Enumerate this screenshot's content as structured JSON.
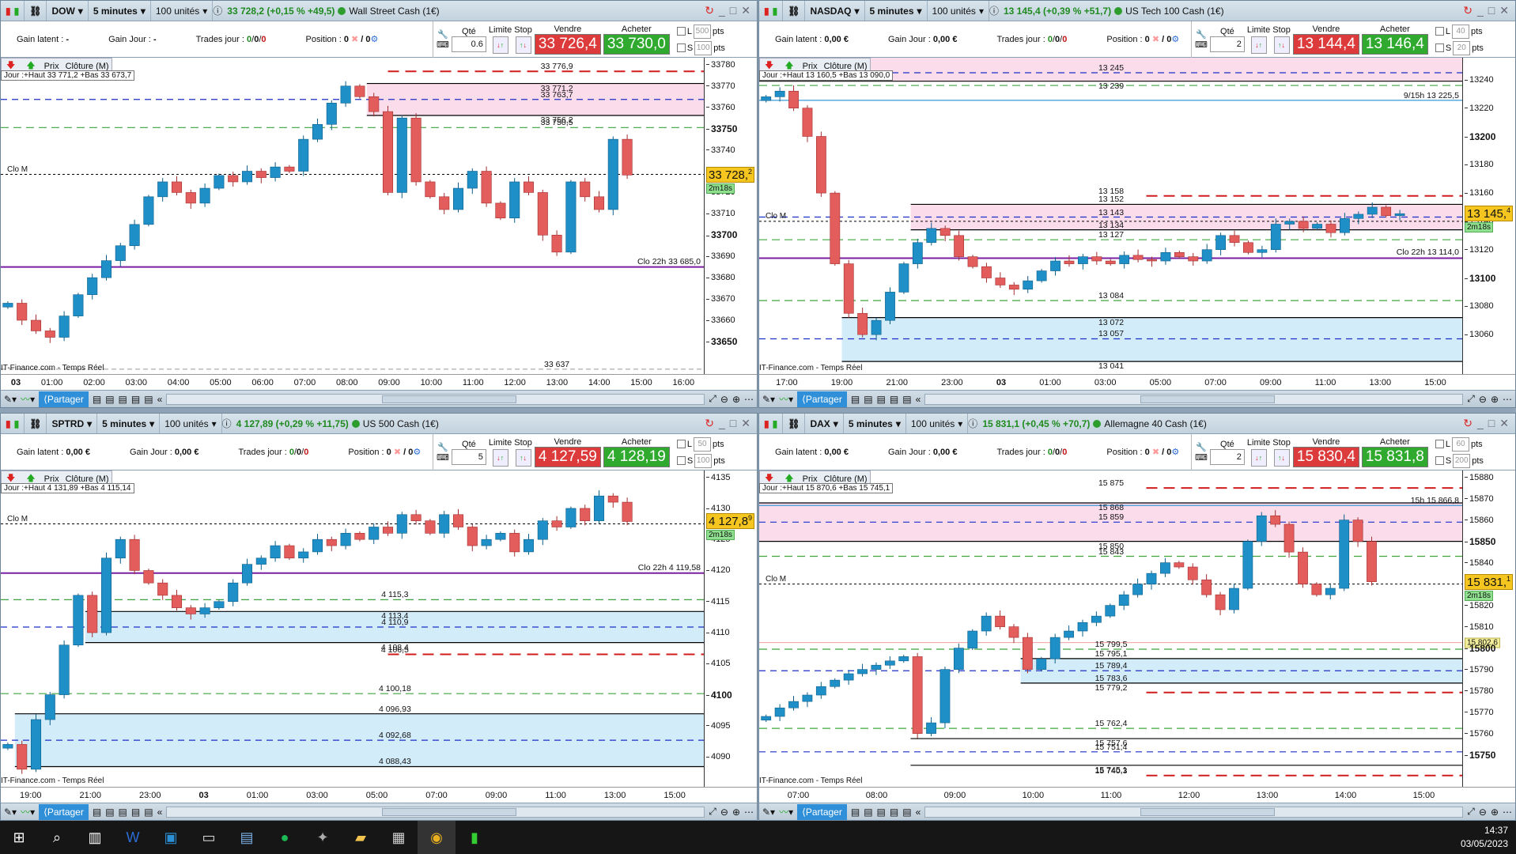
{
  "common": {
    "gain_latent_label": "Gain latent :",
    "gain_jour_label": "Gain Jour :",
    "trades_label": "Trades jour :",
    "position_label": "Position :",
    "qty_label": "Qté",
    "limit_label": "Limite",
    "stop_label": "Stop",
    "sell_label": "Vendre",
    "buy_label": "Acheter",
    "share_label": "Partager",
    "prix_label": "Prix",
    "cloture_label": "Clôture (M)",
    "source": "IT-Finance.com - Temps Réel",
    "clo_m": "Clo M",
    "timer": "2m18s",
    "L": "L",
    "S": "S",
    "pts": "pts",
    "trades": [
      "0",
      "0",
      "0"
    ],
    "position": "0",
    "position2": "/ 0"
  },
  "panels": [
    {
      "symbol": "DOW",
      "interval": "5 minutes",
      "units": "100 unités",
      "quote": "33 728,2 (+0,15 % +49,5)",
      "name": "Wall Street Cash (1€)",
      "gain_latent": "-",
      "gain_jour": "-",
      "qty": "0.6",
      "sell": "33 726,4",
      "buy": "33 730,0",
      "L_pts": "500",
      "S_pts": "100",
      "jour": "Jour :+Haut 33 771,2 +Bas 33 673,7",
      "last": "33 728,2",
      "last_value": 33728.2,
      "clo_m": 33728.5,
      "yrange": [
        33634,
        33783.3
      ],
      "ticks": [
        33650,
        33660,
        33670,
        33680,
        33690,
        33700,
        33710,
        33720,
        33730,
        33740,
        33750,
        33760,
        33770,
        33780
      ],
      "bold_ticks": [
        33650,
        33700,
        33750
      ],
      "times": [
        "03",
        "01:00",
        "02:00",
        "03:00",
        "04:00",
        "05:00",
        "06:00",
        "07:00",
        "08:00",
        "09:00",
        "10:00",
        "11:00",
        "12:00",
        "13:00",
        "14:00",
        "15:00",
        "16:00"
      ],
      "zones": [
        {
          "from": 33756.2,
          "to": 33771.2,
          "color": "#fbdcea",
          "from_index": 26
        }
      ],
      "levels": [
        {
          "price": 33776.9,
          "style": "red",
          "label": "33 776,9"
        },
        {
          "price": 33771.2,
          "style": "black",
          "label": "33 771,2"
        },
        {
          "price": 33763.7,
          "style": "blue",
          "label": "33 763,7"
        },
        {
          "price": 33756.2,
          "style": "black",
          "label": "33 756,2"
        },
        {
          "price": 33750.5,
          "style": "green",
          "label": "33 750,5"
        },
        {
          "price": 33637,
          "style": "grey",
          "label": "33 637"
        }
      ],
      "close_line": {
        "price": 33685.0,
        "label": "Clo 22h 33 685,0"
      },
      "closes": [
        33668,
        33660,
        33655,
        33652,
        33662,
        33672,
        33680,
        33688,
        33695,
        33705,
        33718,
        33725,
        33720,
        33715,
        33722,
        33728,
        33725,
        33730,
        33727,
        33732,
        33730,
        33745,
        33752,
        33762,
        33770,
        33765,
        33758,
        33720,
        33755,
        33725,
        33718,
        33712,
        33722,
        33730,
        33715,
        33708,
        33725,
        33720,
        33700,
        33692,
        33725,
        33718,
        33712,
        33745,
        33728.2
      ]
    },
    {
      "symbol": "NASDAQ",
      "interval": "5 minutes",
      "units": "100 unités",
      "quote": "13 145,4 (+0,39 % +51,7)",
      "name": "US Tech 100 Cash (1€)",
      "gain_latent": "0,00 €",
      "gain_jour": "0,00 €",
      "qty": "2",
      "sell": "13 144,4",
      "buy": "13 146,4",
      "L_pts": "40",
      "S_pts": "20",
      "jour": "Jour :+Haut 13 160,5 +Bas 13 090,0",
      "last": "13 145,4",
      "last_value": 13145.4,
      "clo_m": 13140,
      "yrange": [
        13031,
        13255.6
      ],
      "ticks": [
        13060,
        13080,
        13100,
        13120,
        13140,
        13160,
        13180,
        13200,
        13220,
        13240
      ],
      "bold_ticks": [
        13100,
        13200
      ],
      "times": [
        "17:00",
        "19:00",
        "21:00",
        "23:00",
        "03",
        "01:00",
        "03:00",
        "05:00",
        "07:00",
        "09:00",
        "11:00",
        "13:00",
        "15:00"
      ],
      "zones": [
        {
          "from": 13239,
          "to": 13260,
          "color": "#fbdcea",
          "from_index": 0
        },
        {
          "from": 13134,
          "to": 13152,
          "color": "#fbdcea",
          "from_index": 11
        },
        {
          "from": 13041,
          "to": 13072,
          "color": "#d3ecfa",
          "from_index": 6
        }
      ],
      "levels": [
        {
          "price": 13245,
          "style": "blue",
          "label": "13 245"
        },
        {
          "price": 13239,
          "style": "black",
          "label": "13 239"
        },
        {
          "price": 13236,
          "style": "green",
          "label": ""
        },
        {
          "price": 13158,
          "style": "red",
          "label": "13 158"
        },
        {
          "price": 13152,
          "style": "black",
          "label": "13 152"
        },
        {
          "price": 13143,
          "style": "blue",
          "label": "13 143"
        },
        {
          "price": 13134,
          "style": "black",
          "label": "13 134"
        },
        {
          "price": 13127,
          "style": "green",
          "label": "13 127"
        },
        {
          "price": 13084,
          "style": "green",
          "label": "13 084"
        },
        {
          "price": 13072,
          "style": "black",
          "label": "13 072"
        },
        {
          "price": 13057,
          "style": "blue",
          "label": "13 057"
        },
        {
          "price": 13041,
          "style": "black",
          "label": "13 041"
        }
      ],
      "info_line": {
        "price": 13225.5,
        "label": "9/15h 13 225,5"
      },
      "close_line": {
        "price": 13114.0,
        "label": "Clo 22h 13 114,0"
      },
      "closes": [
        13228,
        13232,
        13220,
        13200,
        13160,
        13110,
        13075,
        13060,
        13070,
        13090,
        13110,
        13125,
        13135,
        13130,
        13115,
        13108,
        13100,
        13095,
        13092,
        13098,
        13105,
        13112,
        13110,
        13115,
        13112,
        13110,
        13116,
        13113,
        13112,
        13118,
        13115,
        13112,
        13120,
        13130,
        13125,
        13118,
        13120,
        13138,
        13140,
        13135,
        13138,
        13132,
        13142,
        13145,
        13150,
        13144,
        13145.4
      ]
    },
    {
      "symbol": "SPTRD",
      "interval": "5 minutes",
      "units": "100 unités",
      "quote": "4 127,89 (+0,29 % +11,75)",
      "name": "US 500 Cash (1€)",
      "gain_latent": "0,00 €",
      "gain_jour": "0,00 €",
      "qty": "5",
      "sell": "4 127,59",
      "buy": "4 128,19",
      "L_pts": "50",
      "S_pts": "100",
      "jour": "Jour :+Haut 4 131,89 +Bas 4 115,14",
      "last": "4 127,89",
      "last_value": 4127.89,
      "clo_m": 4127.5,
      "yrange": [
        4086.2,
        4136.1
      ],
      "ticks": [
        4090,
        4095,
        4100,
        4105,
        4110,
        4115,
        4120,
        4125,
        4130,
        4135
      ],
      "bold_ticks": [
        4100
      ],
      "times": [
        "19:00",
        "21:00",
        "23:00",
        "03",
        "01:00",
        "03:00",
        "05:00",
        "07:00",
        "09:00",
        "11:00",
        "13:00",
        "15:00"
      ],
      "zones": [
        {
          "from": 4108.4,
          "to": 4113.4,
          "color": "#d3ecfa",
          "from_index": 6
        },
        {
          "from": 4088.43,
          "to": 4096.93,
          "color": "#d3ecfa",
          "from_index": 1
        }
      ],
      "levels": [
        {
          "price": 4115.3,
          "style": "green",
          "label": "4 115,3"
        },
        {
          "price": 4113.4,
          "style": "black",
          "label": "4 113,4"
        },
        {
          "price": 4110.9,
          "style": "blue",
          "label": "4 110,9"
        },
        {
          "price": 4108.4,
          "style": "black",
          "label": "4 108,4"
        },
        {
          "price": 4106.5,
          "style": "red",
          "label": "4 106,5"
        },
        {
          "price": 4100.18,
          "style": "green",
          "label": "4 100,18"
        },
        {
          "price": 4096.93,
          "style": "black",
          "label": "4 096,93"
        },
        {
          "price": 4092.68,
          "style": "blue",
          "label": "4 092,68"
        },
        {
          "price": 4088.43,
          "style": "black",
          "label": "4 088,43"
        }
      ],
      "close_line": {
        "price": 4119.58,
        "label": "Clo 22h 4 119,58"
      },
      "closes": [
        4092,
        4088,
        4096,
        4100,
        4108,
        4116,
        4110,
        4122,
        4125,
        4120,
        4118,
        4116,
        4114,
        4113,
        4114,
        4115,
        4118,
        4121,
        4122,
        4124,
        4122,
        4123,
        4125,
        4124,
        4126,
        4125,
        4127,
        4126,
        4129,
        4128,
        4126,
        4129,
        4127,
        4124,
        4125,
        4126,
        4123,
        4125,
        4128,
        4127,
        4130,
        4128,
        4132,
        4131,
        4127.89
      ]
    },
    {
      "symbol": "DAX",
      "interval": "5 minutes",
      "units": "100 unités",
      "quote": "15 831,1 (+0,45 % +70,7)",
      "name": "Allemagne 40 Cash (1€)",
      "gain_latent": "0,00 €",
      "gain_jour": "0,00 €",
      "qty": "2",
      "sell": "15 830,4",
      "buy": "15 831,8",
      "L_pts": "60",
      "S_pts": "200",
      "jour": "Jour :+Haut 15 870,6 +Bas 15 745,1",
      "last": "15 831,1",
      "last_value": 15831.1,
      "clo_m": 15830,
      "yrange": [
        15738,
        15883.2
      ],
      "ticks": [
        15750,
        15760,
        15770,
        15780,
        15790,
        15800,
        15810,
        15820,
        15830,
        15840,
        15850,
        15860,
        15870,
        15880
      ],
      "bold_ticks": [
        15750,
        15800,
        15850
      ],
      "times": [
        "07:00",
        "08:00",
        "09:00",
        "10:00",
        "11:00",
        "12:00",
        "13:00",
        "14:00",
        "15:00"
      ],
      "zones": [
        {
          "from": 15850,
          "to": 15868,
          "color": "#fbdcea",
          "from_index": 0
        },
        {
          "from": 15783.6,
          "to": 15795.1,
          "color": "#d3ecfa",
          "from_index": 19
        },
        {
          "from": 15745.1,
          "to": 15757.6,
          "color": "#fff",
          "from_index": 11
        }
      ],
      "levels": [
        {
          "price": 15875,
          "style": "red",
          "label": "15 875"
        },
        {
          "price": 15868,
          "style": "black",
          "label": "15 868"
        },
        {
          "price": 15859,
          "style": "blue",
          "label": "15 859"
        },
        {
          "price": 15850,
          "style": "black",
          "label": "15 850"
        },
        {
          "price": 15843,
          "style": "green",
          "label": "15 843"
        },
        {
          "price": 15799.5,
          "style": "green",
          "label": "15 799,5"
        },
        {
          "price": 15795.1,
          "style": "black",
          "label": "15 795,1"
        },
        {
          "price": 15789.4,
          "style": "blue",
          "label": "15 789,4"
        },
        {
          "price": 15783.6,
          "style": "black",
          "label": "15 783,6"
        },
        {
          "price": 15779.2,
          "style": "red",
          "label": "15 779,2"
        },
        {
          "price": 15762.4,
          "style": "green",
          "label": "15 762,4"
        },
        {
          "price": 15757.6,
          "style": "black",
          "label": "15 757,6"
        },
        {
          "price": 15751.4,
          "style": "blue",
          "label": "15 751,4"
        },
        {
          "price": 15745.1,
          "style": "black",
          "label": "15 745,1"
        },
        {
          "price": 15740.3,
          "style": "red",
          "label": "15 740,3"
        }
      ],
      "info_line": {
        "price": 15866.8,
        "label": "15h 15 866,8"
      },
      "prev_line": {
        "price": 15802.6,
        "label": "15 802,6"
      },
      "closes": [
        15768,
        15772,
        15775,
        15778,
        15782,
        15785,
        15788,
        15790,
        15792,
        15794,
        15796,
        15760,
        15765,
        15790,
        15800,
        15808,
        15815,
        15810,
        15805,
        15790,
        15795,
        15805,
        15808,
        15812,
        15815,
        15820,
        15825,
        15830,
        15835,
        15840,
        15838,
        15832,
        15825,
        15818,
        15828,
        15850,
        15862,
        15858,
        15845,
        15830,
        15825,
        15828,
        15860,
        15850,
        15831.1
      ]
    }
  ],
  "taskbar": {
    "time": "14:37",
    "date": "03/05/2023",
    "icons": [
      "windows-start",
      "search",
      "task-view",
      "word",
      "teams",
      "file-explorer",
      "store",
      "spotify",
      "app",
      "folder",
      "calculator",
      "chrome",
      "trading-app"
    ]
  },
  "colors": {
    "up": "#1f8fc8",
    "down": "#e35d5d",
    "red": "#d01c1c",
    "blue": "#1c2fc8",
    "green": "#3ea53e",
    "purple": "#7a1fa2"
  }
}
